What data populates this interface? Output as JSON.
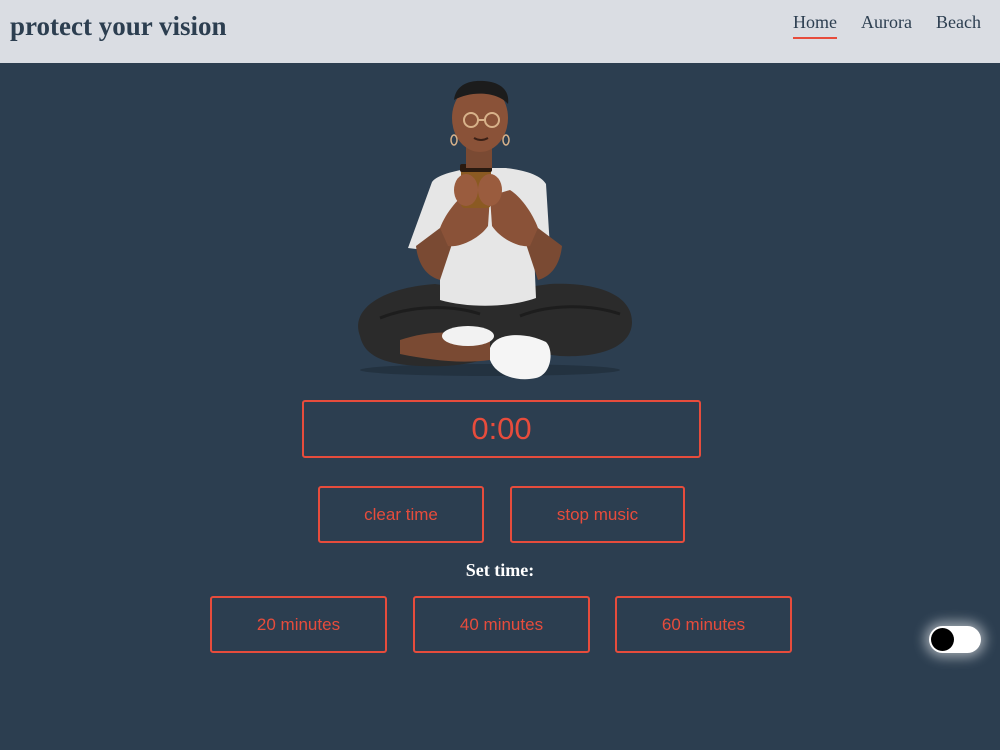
{
  "header": {
    "brand": "protect your vision",
    "nav": [
      {
        "label": "Home",
        "active": true
      },
      {
        "label": "Aurora",
        "active": false
      },
      {
        "label": "Beach",
        "active": false
      }
    ]
  },
  "timer": {
    "display": "0:00"
  },
  "controls": {
    "clear_label": "clear time",
    "stop_label": "stop music"
  },
  "set_time": {
    "label": "Set time:",
    "options": [
      "20 minutes",
      "40 minutes",
      "60 minutes"
    ]
  },
  "theme_toggle": {
    "state": "off"
  },
  "colors": {
    "background": "#2c3e50",
    "header": "#dadde3",
    "accent": "#e74c3c"
  }
}
